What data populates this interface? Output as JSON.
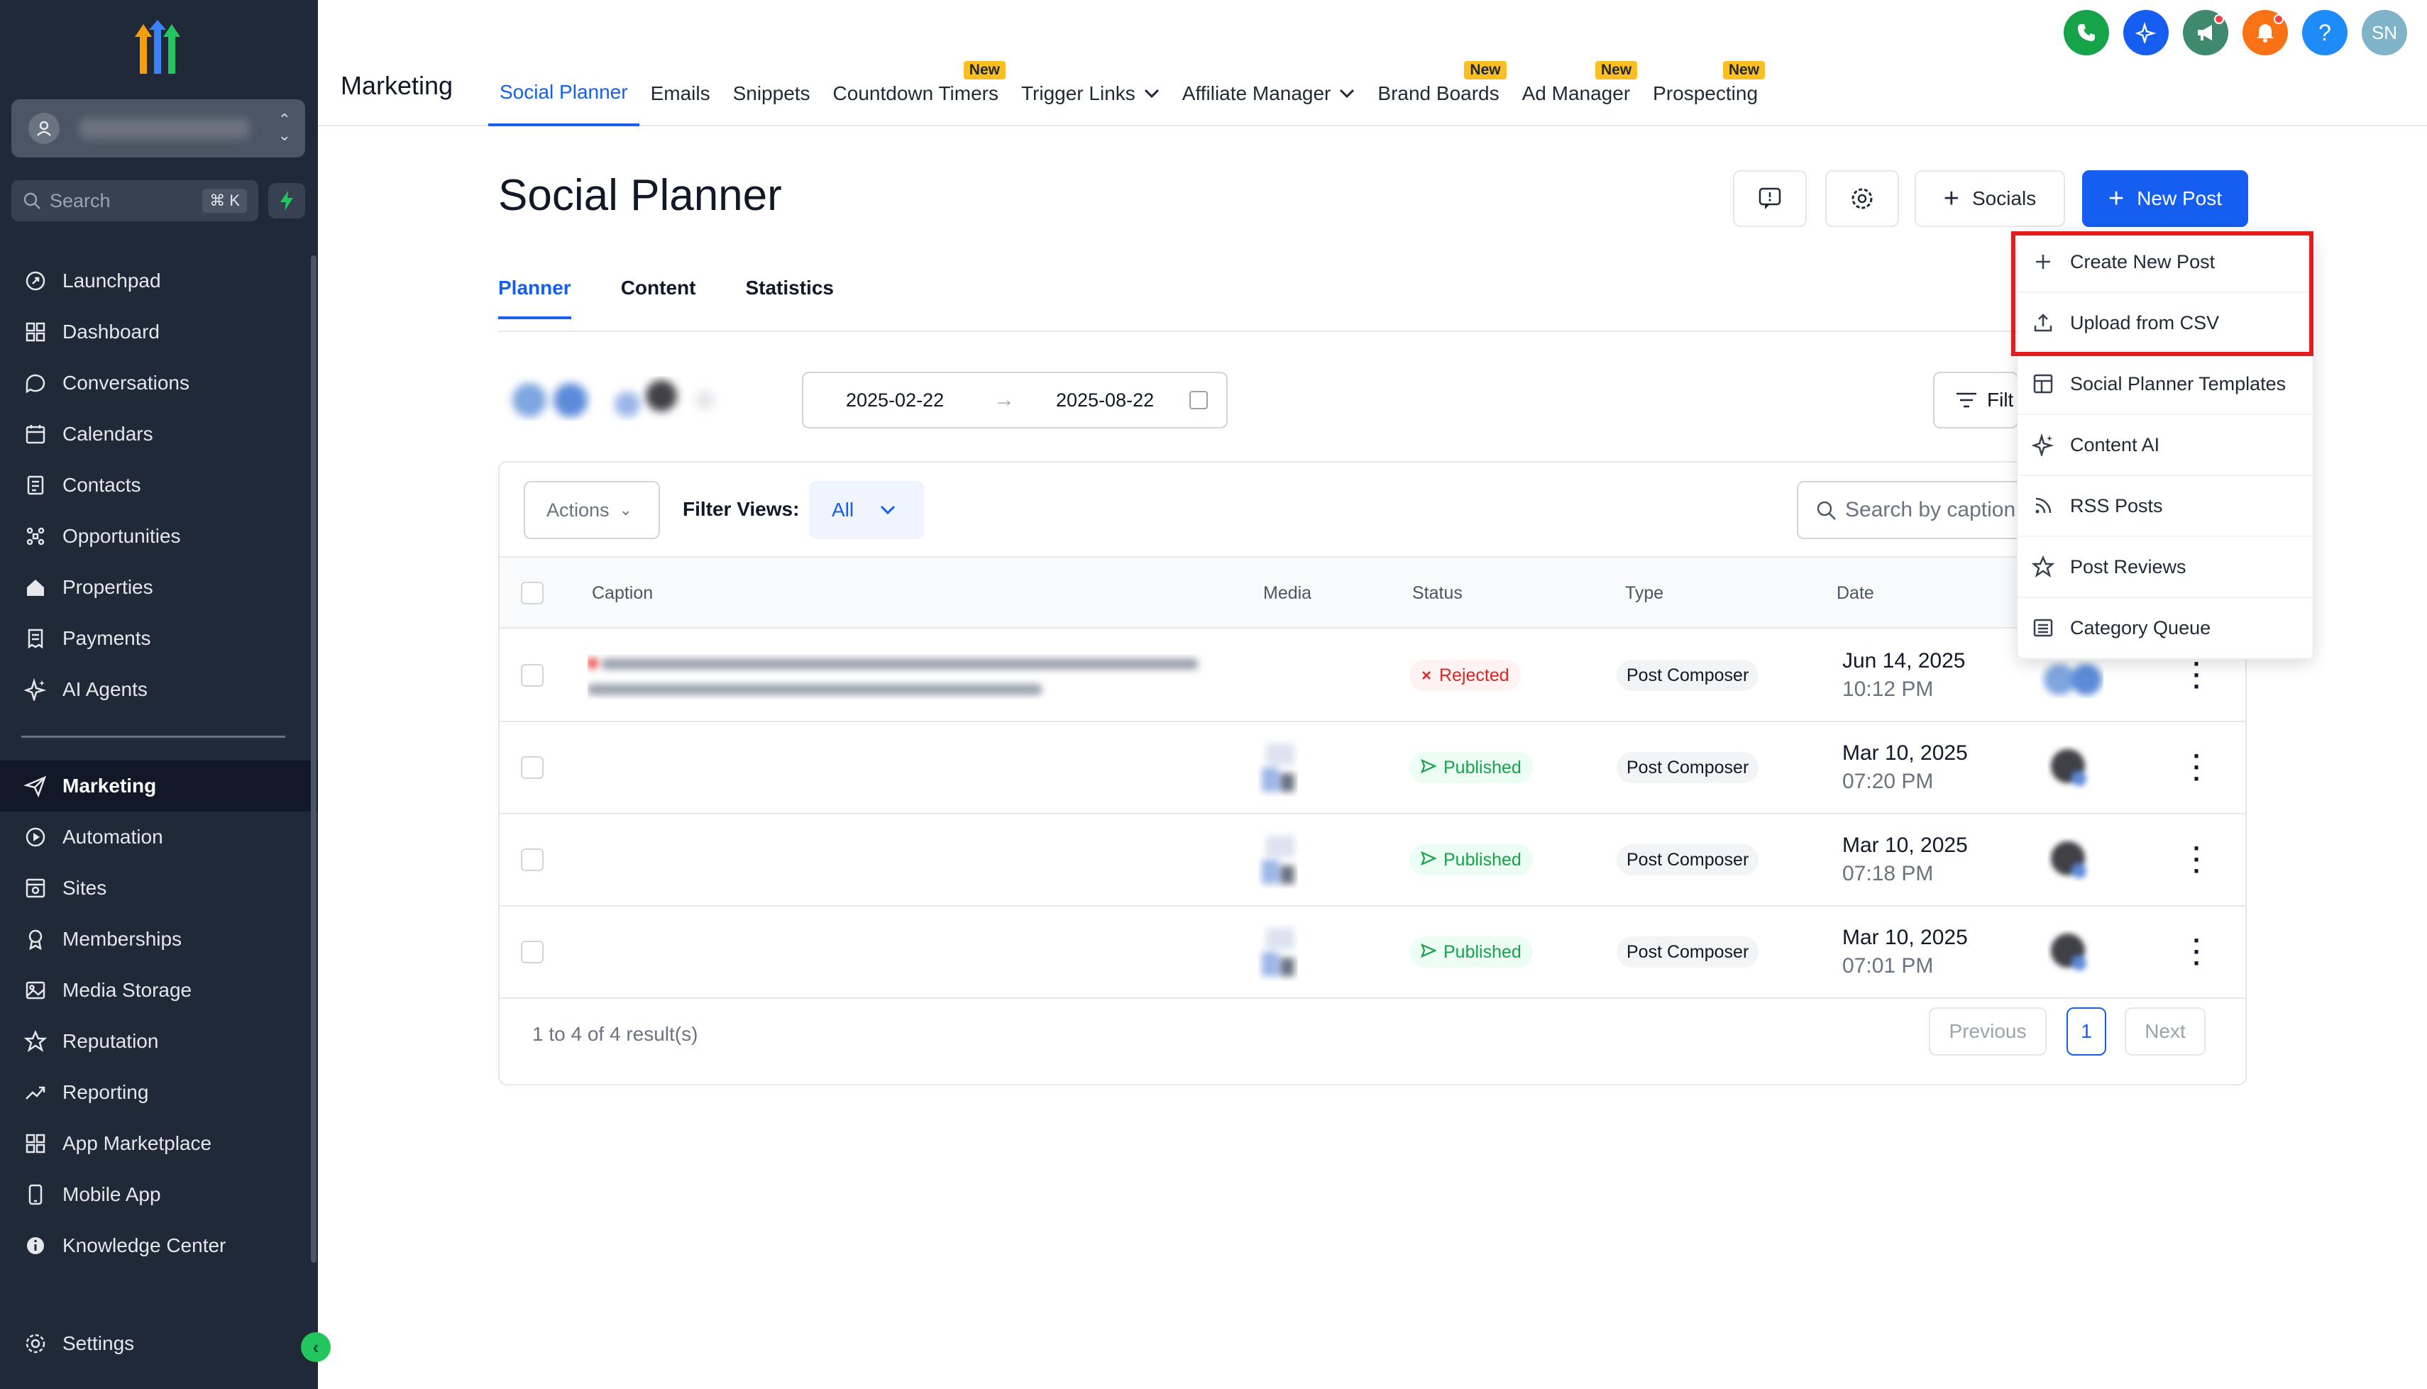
{
  "sidebar": {
    "search": {
      "placeholder": "Search",
      "shortcut": "⌘ K"
    },
    "items": [
      {
        "label": "Launchpad",
        "icon": "rocket-icon"
      },
      {
        "label": "Dashboard",
        "icon": "grid-icon"
      },
      {
        "label": "Conversations",
        "icon": "chat-icon"
      },
      {
        "label": "Calendars",
        "icon": "calendar-icon"
      },
      {
        "label": "Contacts",
        "icon": "contacts-icon"
      },
      {
        "label": "Opportunities",
        "icon": "opportunities-icon"
      },
      {
        "label": "Properties",
        "icon": "home-icon"
      },
      {
        "label": "Payments",
        "icon": "receipt-icon"
      },
      {
        "label": "AI Agents",
        "icon": "sparkle-icon"
      },
      {
        "label": "Marketing",
        "icon": "send-icon",
        "active": true
      },
      {
        "label": "Automation",
        "icon": "automation-icon"
      },
      {
        "label": "Sites",
        "icon": "sites-icon"
      },
      {
        "label": "Memberships",
        "icon": "award-icon"
      },
      {
        "label": "Media Storage",
        "icon": "image-icon"
      },
      {
        "label": "Reputation",
        "icon": "star-icon"
      },
      {
        "label": "Reporting",
        "icon": "trend-icon"
      },
      {
        "label": "App Marketplace",
        "icon": "apps-icon"
      },
      {
        "label": "Mobile App",
        "icon": "mobile-icon"
      },
      {
        "label": "Knowledge Center",
        "icon": "info-icon"
      }
    ],
    "settings_label": "Settings"
  },
  "topbar": {
    "section": "Marketing",
    "tabs": [
      {
        "label": "Social Planner",
        "active": true
      },
      {
        "label": "Emails"
      },
      {
        "label": "Snippets"
      },
      {
        "label": "Countdown Timers",
        "badge": "New"
      },
      {
        "label": "Trigger Links",
        "dropdown": true
      },
      {
        "label": "Affiliate Manager",
        "dropdown": true
      },
      {
        "label": "Brand Boards",
        "badge": "New"
      },
      {
        "label": "Ad Manager",
        "badge": "New"
      },
      {
        "label": "Prospecting",
        "badge": "New"
      }
    ],
    "icons": [
      {
        "name": "phone-icon",
        "color": "#16a34a"
      },
      {
        "name": "ai-sparkle-icon",
        "color": "#155eef"
      },
      {
        "name": "megaphone-icon",
        "color": "#3f8a6e"
      },
      {
        "name": "bell-icon",
        "color": "#f97316"
      },
      {
        "name": "help-icon",
        "color": "#1d8cf8",
        "glyph": "?"
      },
      {
        "name": "user-avatar",
        "color": "#7fb3c8",
        "glyph": "SN"
      }
    ]
  },
  "page": {
    "title": "Social Planner",
    "socials_label": "Socials",
    "new_post_label": "New Post",
    "subtabs": [
      "Planner",
      "Content",
      "Statistics"
    ],
    "date_start": "2025-02-22",
    "date_end": "2025-08-22",
    "filter_label": "Filt",
    "actions_label": "Actions",
    "filter_views_label": "Filter Views:",
    "filter_views_value": "All",
    "search_placeholder": "Search by caption",
    "columns": [
      "Caption",
      "Media",
      "Status",
      "Type",
      "Date"
    ],
    "rows": [
      {
        "status": "Rejected",
        "type": "Post Composer",
        "date": "Jun 14, 2025",
        "time": "10:12 PM"
      },
      {
        "status": "Published",
        "type": "Post Composer",
        "date": "Mar 10, 2025",
        "time": "07:20 PM"
      },
      {
        "status": "Published",
        "type": "Post Composer",
        "date": "Mar 10, 2025",
        "time": "07:18 PM"
      },
      {
        "status": "Published",
        "type": "Post Composer",
        "date": "Mar 10, 2025",
        "time": "07:01 PM"
      }
    ],
    "pagination": {
      "summary": "1 to 4 of 4 result(s)",
      "previous": "Previous",
      "page": "1",
      "next": "Next"
    }
  },
  "dropdown": {
    "items": [
      {
        "label": "Create New Post",
        "icon": "plus-icon"
      },
      {
        "label": "Upload from CSV",
        "icon": "upload-icon"
      },
      {
        "label": "Social Planner Templates",
        "icon": "template-icon"
      },
      {
        "label": "Content AI",
        "icon": "sparkle-icon"
      },
      {
        "label": "RSS Posts",
        "icon": "rss-icon"
      },
      {
        "label": "Post Reviews",
        "icon": "star-icon"
      },
      {
        "label": "Category Queue",
        "icon": "queue-icon"
      }
    ]
  },
  "colors": {
    "accent": "#155eef",
    "sidebar": "#1f2937",
    "rejected": "#dc2626",
    "published": "#16a34a",
    "highlight": "#e11d1d"
  }
}
